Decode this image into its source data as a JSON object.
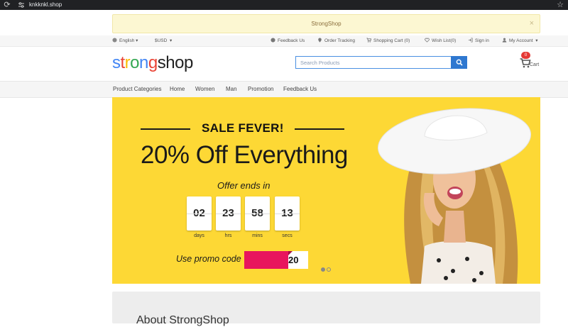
{
  "browser": {
    "url": "knkknkl.shop"
  },
  "notice": {
    "text": "StrongShop",
    "close": "×"
  },
  "topbar": {
    "language": "English",
    "currency": "$USD",
    "feedback": "Feedback Us",
    "order_tracking": "Order Tracking",
    "cart": "Shopping Cart (0)",
    "wishlist": "Wish List(0)",
    "signin": "Sign in",
    "account": "My Account"
  },
  "logo": {
    "p1": "s",
    "p2": "t",
    "p3": "r",
    "p4": "o",
    "p5": "n",
    "p6": "g",
    "rest": "shop"
  },
  "search": {
    "placeholder": "Search Products"
  },
  "cart": {
    "count": "0",
    "label": "Cart"
  },
  "nav": [
    "Product Categories",
    "Home",
    "Women",
    "Man",
    "Promotion",
    "Feedback Us"
  ],
  "banner": {
    "sale": "SALE FEVER!",
    "headline": "20% Off Everything",
    "offer": "Offer ends in",
    "countdown": [
      {
        "value": "02",
        "label": "days"
      },
      {
        "value": "23",
        "label": "hrs"
      },
      {
        "value": "58",
        "label": "mins"
      },
      {
        "value": "13",
        "label": "secs"
      }
    ],
    "promo": "Use promo code",
    "code_visible": "20",
    "slides": 2,
    "active_slide": 1
  },
  "about": {
    "heading": "About StrongShop"
  },
  "colors": {
    "banner": "#fdd835",
    "accent": "#2f78d0",
    "promo_mask": "#e8155d",
    "badge": "#e53935"
  }
}
